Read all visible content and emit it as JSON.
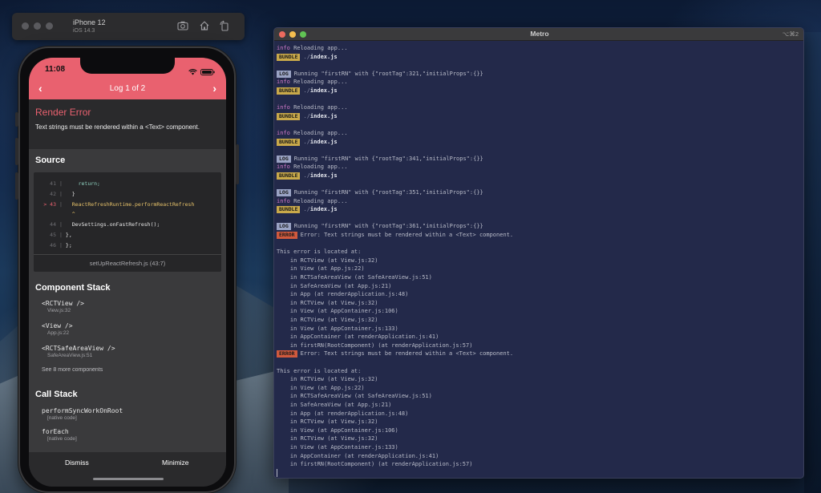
{
  "simulator": {
    "device_name": "iPhone 12",
    "os_version": "iOS 14.3",
    "icons": [
      "screenshot-icon",
      "home-icon",
      "rotate-icon"
    ]
  },
  "phone": {
    "time": "11:08",
    "nav_title": "Log 1 of 2",
    "nav_prev": "‹",
    "nav_next": "›",
    "error_title": "Render Error",
    "error_message": "Text strings must be rendered within a <Text> component.",
    "source_title": "Source",
    "code_lines": [
      {
        "num": "41",
        "marker": "",
        "text": "    return;",
        "color": "#8fd3c0"
      },
      {
        "num": "42",
        "marker": "",
        "text": "  }",
        "color": "#e6e6e6"
      },
      {
        "num": "43",
        "marker": ">",
        "text": "  ReactRefreshRuntime.performReactRefresh",
        "color": "#e8c36a"
      },
      {
        "num": "",
        "marker": "",
        "text": "  ^",
        "color": "#e8c36a"
      },
      {
        "num": "44",
        "marker": "",
        "text": "  DevSettings.onFastRefresh();",
        "color": "#e6e6e6"
      },
      {
        "num": "45",
        "marker": "",
        "text": "},",
        "color": "#e6e6e6"
      },
      {
        "num": "46",
        "marker": "",
        "text": "};",
        "color": "#e6e6e6"
      }
    ],
    "code_footer": "setUpReactRefresh.js (43:7)",
    "component_stack_title": "Component Stack",
    "component_stack": [
      {
        "name": "<RCTView />",
        "loc": "View.js:32"
      },
      {
        "name": "<View />",
        "loc": "App.js:22"
      },
      {
        "name": "<RCTSafeAreaView />",
        "loc": "SafeAreaView.js:51"
      }
    ],
    "see_more": "See 8 more components",
    "call_stack_title": "Call Stack",
    "call_stack": [
      {
        "name": "performSyncWorkOnRoot",
        "loc": "[native code]"
      },
      {
        "name": "forEach",
        "loc": "[native code]"
      }
    ],
    "dismiss_label": "Dismiss",
    "minimize_label": "Minimize"
  },
  "metro": {
    "title": "Metro",
    "shortcut": "⌥⌘2",
    "lines": [
      {
        "kind": "info",
        "text": "Reloading app..."
      },
      {
        "kind": "bundle",
        "text": "./index.js"
      },
      {
        "kind": "blank"
      },
      {
        "kind": "log",
        "text": "Running \"firstRN\" with {\"rootTag\":321,\"initialProps\":{}}"
      },
      {
        "kind": "info",
        "text": "Reloading app..."
      },
      {
        "kind": "bundle",
        "text": "./index.js"
      },
      {
        "kind": "blank"
      },
      {
        "kind": "info",
        "text": "Reloading app..."
      },
      {
        "kind": "bundle",
        "text": "./index.js"
      },
      {
        "kind": "blank"
      },
      {
        "kind": "info",
        "text": "Reloading app..."
      },
      {
        "kind": "bundle",
        "text": "./index.js"
      },
      {
        "kind": "blank"
      },
      {
        "kind": "log",
        "text": "Running \"firstRN\" with {\"rootTag\":341,\"initialProps\":{}}"
      },
      {
        "kind": "info",
        "text": "Reloading app..."
      },
      {
        "kind": "bundle",
        "text": "./index.js"
      },
      {
        "kind": "blank"
      },
      {
        "kind": "log",
        "text": "Running \"firstRN\" with {\"rootTag\":351,\"initialProps\":{}}"
      },
      {
        "kind": "info",
        "text": "Reloading app..."
      },
      {
        "kind": "bundle",
        "text": "./index.js"
      },
      {
        "kind": "blank"
      },
      {
        "kind": "log",
        "text": "Running \"firstRN\" with {\"rootTag\":361,\"initialProps\":{}}"
      },
      {
        "kind": "error",
        "text": "Error: Text strings must be rendered within a <Text> component."
      },
      {
        "kind": "blank"
      },
      {
        "kind": "plain",
        "text": "This error is located at:"
      },
      {
        "kind": "plain",
        "text": "    in RCTView (at View.js:32)"
      },
      {
        "kind": "plain",
        "text": "    in View (at App.js:22)"
      },
      {
        "kind": "plain",
        "text": "    in RCTSafeAreaView (at SafeAreaView.js:51)"
      },
      {
        "kind": "plain",
        "text": "    in SafeAreaView (at App.js:21)"
      },
      {
        "kind": "plain",
        "text": "    in App (at renderApplication.js:48)"
      },
      {
        "kind": "plain",
        "text": "    in RCTView (at View.js:32)"
      },
      {
        "kind": "plain",
        "text": "    in View (at AppContainer.js:106)"
      },
      {
        "kind": "plain",
        "text": "    in RCTView (at View.js:32)"
      },
      {
        "kind": "plain",
        "text": "    in View (at AppContainer.js:133)"
      },
      {
        "kind": "plain",
        "text": "    in AppContainer (at renderApplication.js:41)"
      },
      {
        "kind": "plain",
        "text": "    in firstRN(RootComponent) (at renderApplication.js:57)"
      },
      {
        "kind": "error",
        "text": "Error: Text strings must be rendered within a <Text> component."
      },
      {
        "kind": "blank"
      },
      {
        "kind": "plain",
        "text": "This error is located at:"
      },
      {
        "kind": "plain",
        "text": "    in RCTView (at View.js:32)"
      },
      {
        "kind": "plain",
        "text": "    in View (at App.js:22)"
      },
      {
        "kind": "plain",
        "text": "    in RCTSafeAreaView (at SafeAreaView.js:51)"
      },
      {
        "kind": "plain",
        "text": "    in SafeAreaView (at App.js:21)"
      },
      {
        "kind": "plain",
        "text": "    in App (at renderApplication.js:48)"
      },
      {
        "kind": "plain",
        "text": "    in RCTView (at View.js:32)"
      },
      {
        "kind": "plain",
        "text": "    in View (at AppContainer.js:106)"
      },
      {
        "kind": "plain",
        "text": "    in RCTView (at View.js:32)"
      },
      {
        "kind": "plain",
        "text": "    in View (at AppContainer.js:133)"
      },
      {
        "kind": "plain",
        "text": "    in AppContainer (at renderApplication.js:41)"
      },
      {
        "kind": "plain",
        "text": "    in firstRN(RootComponent) (at renderApplication.js:57)"
      },
      {
        "kind": "cursor"
      }
    ],
    "tag_labels": {
      "bundle": "BUNDLE",
      "log": "LOG",
      "error": "ERROR",
      "info": "info",
      "bundle_prefix": "./"
    }
  },
  "colors": {
    "accent_red": "#e9616f",
    "terminal_bg": "#23294a",
    "info_color": "#d079c8"
  }
}
